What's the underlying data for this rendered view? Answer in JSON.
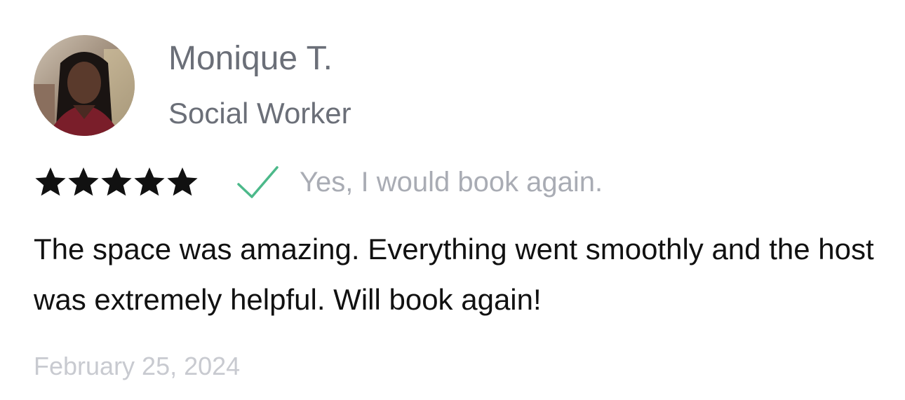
{
  "review": {
    "reviewer_name": "Monique T.",
    "reviewer_job": "Social Worker",
    "rating": 5,
    "rating_max": 5,
    "would_book_again": "Yes, I would book again.",
    "text": "The space was amazing. Everything went smoothly and the host was extremely helpful. Will book again!",
    "date": "February 25, 2024"
  },
  "icons": {
    "star": "star-icon",
    "check": "checkmark-icon",
    "avatar": "user-avatar-photo"
  },
  "colors": {
    "star_fill": "#111111",
    "check": "#4cb98a",
    "muted_text": "#a9acb4",
    "name_text": "#6b6f78",
    "date_text": "#c8cad0",
    "body_text": "#111111"
  }
}
